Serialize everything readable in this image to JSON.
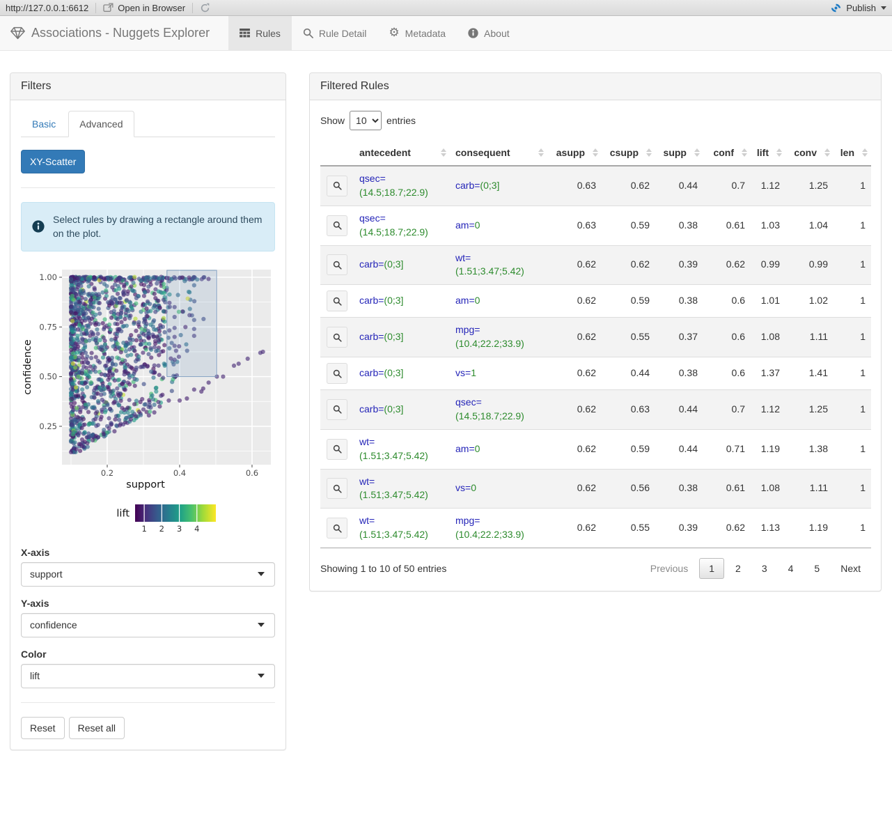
{
  "browser_bar": {
    "url": "http://127.0.0.1:6612",
    "open_in_browser": "Open in Browser",
    "publish": "Publish"
  },
  "navbar": {
    "brand": "Associations - Nuggets Explorer",
    "tabs": [
      {
        "label": "Rules",
        "icon": "table-icon",
        "active": true
      },
      {
        "label": "Rule Detail",
        "icon": "search-icon",
        "active": false
      },
      {
        "label": "Metadata",
        "icon": "gear-icon",
        "active": false
      },
      {
        "label": "About",
        "icon": "info-icon",
        "active": false
      }
    ]
  },
  "filters": {
    "title": "Filters",
    "tabs": [
      {
        "label": "Basic",
        "active": false
      },
      {
        "label": "Advanced",
        "active": true
      }
    ],
    "scatter_button": "XY-Scatter",
    "alert": "Select rules by drawing a rectangle around them on the plot.",
    "x_axis": {
      "label": "X-axis",
      "value": "support"
    },
    "y_axis": {
      "label": "Y-axis",
      "value": "confidence"
    },
    "color": {
      "label": "Color",
      "value": "lift"
    },
    "reset_label": "Reset",
    "reset_all_label": "Reset all"
  },
  "chart_data": {
    "type": "scatter",
    "xlabel": "support",
    "ylabel": "confidence",
    "x_tick_values": [
      0.2,
      0.4,
      0.6
    ],
    "x_tick_labels": [
      "0.2",
      "0.4",
      "0.6"
    ],
    "y_tick_values": [
      0.25,
      0.5,
      0.75,
      1.0
    ],
    "y_tick_labels": [
      "0.25",
      "0.50",
      "0.75",
      "1.00"
    ],
    "x_minor_ticks": [
      0.1,
      0.3,
      0.5
    ],
    "y_minor_ticks": [
      0.125,
      0.375,
      0.625,
      0.875
    ],
    "xlim": [
      0.075,
      0.652
    ],
    "ylim": [
      0.057,
      1.0385
    ],
    "grid": true,
    "panel_bg": "#ebebeb",
    "color_legend": {
      "label": "lift",
      "tick_values": [
        1,
        2,
        3,
        4
      ],
      "tick_labels": [
        "1",
        "2",
        "3",
        "4"
      ],
      "range": [
        0.48,
        5.08
      ],
      "palette": "viridis"
    },
    "palette": [
      [
        0.0,
        "#440154"
      ],
      [
        0.14,
        "#46327e"
      ],
      [
        0.28,
        "#365c8d"
      ],
      [
        0.42,
        "#277f8e"
      ],
      [
        0.56,
        "#1fa187"
      ],
      [
        0.7,
        "#4ac16d"
      ],
      [
        0.84,
        "#a0da39"
      ],
      [
        1.0,
        "#fde725"
      ]
    ],
    "selection_rect": {
      "x0": 0.365,
      "x1": 0.502,
      "y0": 0.5,
      "y1": 1.035
    },
    "n_random_points": 1380,
    "seed": 421,
    "point_radius": 3.1,
    "point_opacity": 0.62,
    "feature_points": [
      [
        0.385,
        1.0,
        1.3
      ],
      [
        0.44,
        1.0,
        1.4
      ],
      [
        0.468,
        1.0,
        1.4
      ],
      [
        0.386,
        0.85,
        1.2
      ],
      [
        0.386,
        0.8,
        1.3
      ],
      [
        0.44,
        0.785,
        1.5
      ],
      [
        0.466,
        0.79,
        1.5
      ],
      [
        0.386,
        0.745,
        1.2
      ],
      [
        0.44,
        0.74,
        1.3
      ],
      [
        0.44,
        0.705,
        1.2
      ],
      [
        0.386,
        0.7,
        1.1
      ],
      [
        0.386,
        0.655,
        1.2
      ],
      [
        0.39,
        0.63,
        1.1
      ],
      [
        0.398,
        0.6,
        1.0
      ],
      [
        0.386,
        0.585,
        1.1
      ],
      [
        0.503,
        0.5,
        1.0
      ],
      [
        0.52,
        0.5,
        0.95
      ],
      [
        0.55,
        0.555,
        1.0
      ],
      [
        0.563,
        0.565,
        1.0
      ],
      [
        0.588,
        0.59,
        1.0
      ],
      [
        0.623,
        0.62,
        1.05
      ],
      [
        0.63,
        0.625,
        1.0
      ],
      [
        0.48,
        0.47,
        0.95
      ],
      [
        0.465,
        0.44,
        0.9
      ],
      [
        0.44,
        0.435,
        0.95
      ],
      [
        0.46,
        0.425,
        0.92
      ],
      [
        0.42,
        0.39,
        0.9
      ],
      [
        0.4,
        0.38,
        0.9
      ],
      [
        0.37,
        0.38,
        0.95
      ],
      [
        0.345,
        0.35,
        0.9
      ],
      [
        0.33,
        0.32,
        0.95
      ],
      [
        0.315,
        0.305,
        0.9
      ],
      [
        0.3,
        0.335,
        0.95
      ],
      [
        0.28,
        0.3,
        0.9
      ],
      [
        0.265,
        0.285,
        0.92
      ],
      [
        0.25,
        0.27,
        0.9
      ],
      [
        0.235,
        0.255,
        0.92
      ],
      [
        0.22,
        0.225,
        0.9
      ],
      [
        0.205,
        0.24,
        0.95
      ],
      [
        0.19,
        0.21,
        0.9
      ],
      [
        0.175,
        0.195,
        0.92
      ],
      [
        0.16,
        0.18,
        0.9
      ],
      [
        0.145,
        0.165,
        0.92
      ],
      [
        0.13,
        0.15,
        0.9
      ],
      [
        0.115,
        0.135,
        0.92
      ],
      [
        0.1,
        0.12,
        0.9
      ],
      [
        0.104,
        0.78,
        4.6
      ],
      [
        0.112,
        0.545,
        4.2
      ],
      [
        0.12,
        0.5,
        3.9
      ]
    ]
  },
  "rules_panel": {
    "title": "Filtered Rules",
    "show_label": "Show",
    "entries_label": "entries",
    "page_length": "10",
    "columns": [
      "",
      "antecedent",
      "consequent",
      "asupp",
      "csupp",
      "supp",
      "conf",
      "lift",
      "conv",
      "len"
    ],
    "rows": [
      {
        "antecedent": {
          "attr": "qsec",
          "value": "(14.5;18.7;22.9)"
        },
        "consequent": {
          "attr": "carb",
          "value": "(0;3]"
        },
        "asupp": 0.63,
        "csupp": 0.62,
        "supp": 0.44,
        "conf": 0.7,
        "lift": 1.12,
        "conv": 1.25,
        "len": 1
      },
      {
        "antecedent": {
          "attr": "qsec",
          "value": "(14.5;18.7;22.9)"
        },
        "consequent": {
          "attr": "am",
          "value": "0"
        },
        "asupp": 0.63,
        "csupp": 0.59,
        "supp": 0.38,
        "conf": 0.61,
        "lift": 1.03,
        "conv": 1.04,
        "len": 1
      },
      {
        "antecedent": {
          "attr": "carb",
          "value": "(0;3]"
        },
        "consequent": {
          "attr": "wt",
          "value": "(1.51;3.47;5.42)"
        },
        "asupp": 0.62,
        "csupp": 0.62,
        "supp": 0.39,
        "conf": 0.62,
        "lift": 0.99,
        "conv": 0.99,
        "len": 1
      },
      {
        "antecedent": {
          "attr": "carb",
          "value": "(0;3]"
        },
        "consequent": {
          "attr": "am",
          "value": "0"
        },
        "asupp": 0.62,
        "csupp": 0.59,
        "supp": 0.38,
        "conf": 0.6,
        "lift": 1.01,
        "conv": 1.02,
        "len": 1
      },
      {
        "antecedent": {
          "attr": "carb",
          "value": "(0;3]"
        },
        "consequent": {
          "attr": "mpg",
          "value": "(10.4;22.2;33.9)"
        },
        "asupp": 0.62,
        "csupp": 0.55,
        "supp": 0.37,
        "conf": 0.6,
        "lift": 1.08,
        "conv": 1.11,
        "len": 1
      },
      {
        "antecedent": {
          "attr": "carb",
          "value": "(0;3]"
        },
        "consequent": {
          "attr": "vs",
          "value": "1"
        },
        "asupp": 0.62,
        "csupp": 0.44,
        "supp": 0.38,
        "conf": 0.6,
        "lift": 1.37,
        "conv": 1.41,
        "len": 1
      },
      {
        "antecedent": {
          "attr": "carb",
          "value": "(0;3]"
        },
        "consequent": {
          "attr": "qsec",
          "value": "(14.5;18.7;22.9)"
        },
        "asupp": 0.62,
        "csupp": 0.63,
        "supp": 0.44,
        "conf": 0.7,
        "lift": 1.12,
        "conv": 1.25,
        "len": 1
      },
      {
        "antecedent": {
          "attr": "wt",
          "value": "(1.51;3.47;5.42)"
        },
        "consequent": {
          "attr": "am",
          "value": "0"
        },
        "asupp": 0.62,
        "csupp": 0.59,
        "supp": 0.44,
        "conf": 0.71,
        "lift": 1.19,
        "conv": 1.38,
        "len": 1
      },
      {
        "antecedent": {
          "attr": "wt",
          "value": "(1.51;3.47;5.42)"
        },
        "consequent": {
          "attr": "vs",
          "value": "0"
        },
        "asupp": 0.62,
        "csupp": 0.56,
        "supp": 0.38,
        "conf": 0.61,
        "lift": 1.08,
        "conv": 1.11,
        "len": 1
      },
      {
        "antecedent": {
          "attr": "wt",
          "value": "(1.51;3.47;5.42)"
        },
        "consequent": {
          "attr": "mpg",
          "value": "(10.4;22.2;33.9)"
        },
        "asupp": 0.62,
        "csupp": 0.55,
        "supp": 0.39,
        "conf": 0.62,
        "lift": 1.13,
        "conv": 1.19,
        "len": 1
      }
    ],
    "info": "Showing 1 to 10 of 50 entries",
    "pagination": {
      "previous": "Previous",
      "pages": [
        "1",
        "2",
        "3",
        "4",
        "5"
      ],
      "active": "1",
      "next": "Next"
    }
  },
  "colors": {
    "accent": "#337ab7",
    "antecedent_attr": "#2424b8",
    "antecedent_value": "#2d8b2d",
    "publish_blue": "#1f7bc4",
    "alert_bg": "#d9edf7"
  }
}
